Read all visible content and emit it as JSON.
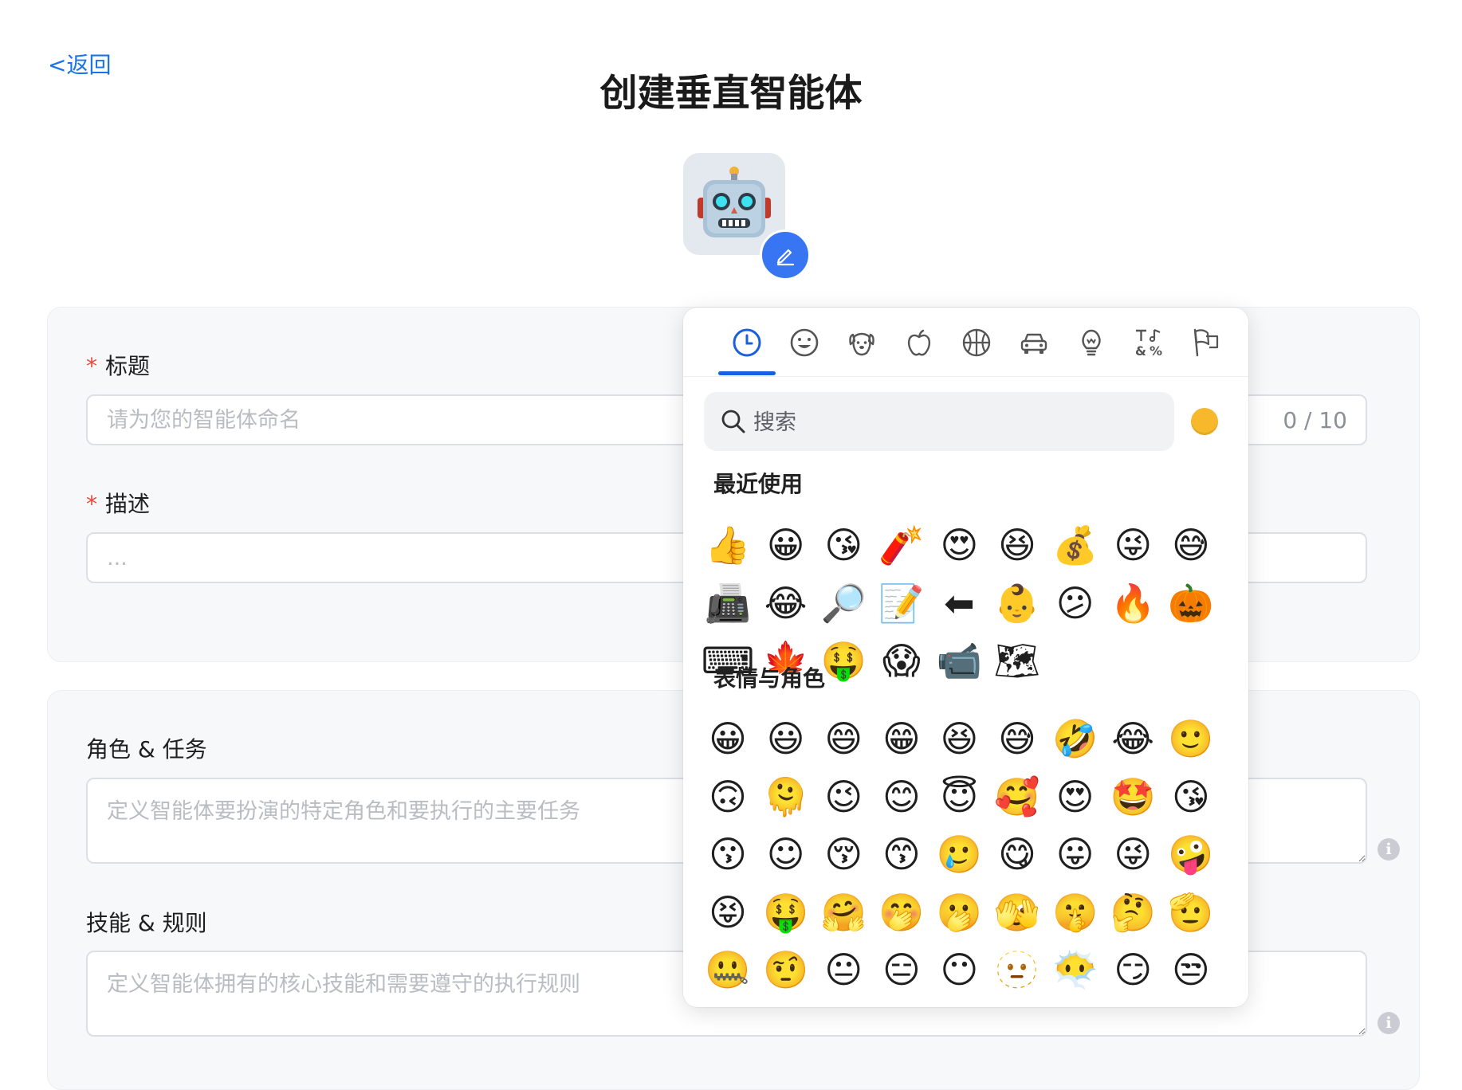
{
  "header": {
    "back_label": "<返回",
    "page_title": "创建垂直智能体"
  },
  "avatar": {
    "emoji": "robot-face",
    "edit_icon": "pencil-icon"
  },
  "form": {
    "title": {
      "required_mark": "*",
      "label": "标题",
      "placeholder": "请为您的智能体命名",
      "counter": "0 / 10"
    },
    "description": {
      "required_mark": "*",
      "label": "描述",
      "placeholder": "..."
    },
    "role": {
      "label": "角色 & 任务",
      "placeholder": "定义智能体要扮演的特定角色和要执行的主要任务"
    },
    "skills": {
      "label": "技能 & 规则",
      "placeholder": "定义智能体拥有的核心技能和需要遵守的执行规则"
    }
  },
  "emoji_picker": {
    "categories": [
      "recent-clock-icon",
      "smiley-icon",
      "dog-face-icon",
      "apple-icon",
      "basketball-icon",
      "car-icon",
      "lightbulb-icon",
      "symbols-icon",
      "flags-icon"
    ],
    "active_category": 0,
    "search_placeholder": "搜索",
    "skin_tone_color": "#F7B82C",
    "accent_color": "#1A5FE0",
    "sections": [
      {
        "title": "最近使用"
      },
      {
        "title": "表情与角色"
      }
    ],
    "recent": [
      "👍",
      "😀",
      "😘",
      "🧨",
      "😍",
      "😆",
      "💰",
      "😜",
      "😅",
      "📠",
      "😂",
      "🔎",
      "📝",
      "⬅",
      "👶",
      "😕",
      "🔥",
      "🎃",
      "⌨",
      "🍁",
      "🤑",
      "😱",
      "📹",
      "🗺"
    ],
    "smileys": [
      "😀",
      "😃",
      "😄",
      "😁",
      "😆",
      "😅",
      "🤣",
      "😂",
      "🙂",
      "🙃",
      "🫠",
      "😉",
      "😊",
      "😇",
      "🥰",
      "😍",
      "🤩",
      "😘",
      "😗",
      "☺",
      "😚",
      "😙",
      "🥲",
      "😋",
      "😛",
      "😜",
      "🤪",
      "😝",
      "🤑",
      "🤗",
      "🤭",
      "🫢",
      "🫣",
      "🤫",
      "🤔",
      "🫡",
      "🤐",
      "🤨",
      "😐",
      "😑",
      "😶",
      "🫥",
      "😶‍🌫️",
      "😏",
      "😒"
    ]
  }
}
